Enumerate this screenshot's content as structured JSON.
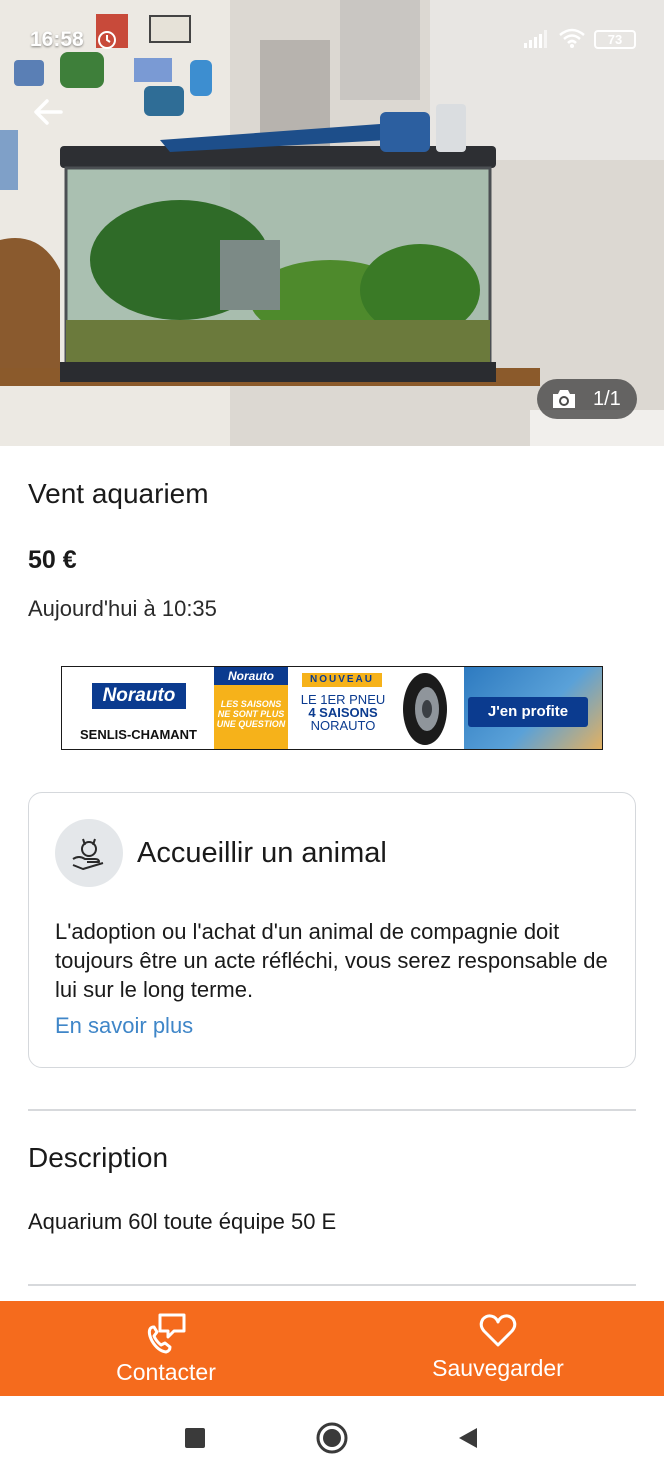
{
  "status_bar": {
    "time": "16:58",
    "battery": "73",
    "icons": [
      "alarm-icon",
      "signal-icon",
      "wifi-icon",
      "battery-icon"
    ]
  },
  "photo": {
    "counter": "1/1",
    "icons": [
      "back-arrow-icon",
      "camera-icon"
    ]
  },
  "listing": {
    "title": "Vent aquariem",
    "price": "50 €",
    "date": "Aujourd'hui à 10:35"
  },
  "ad": {
    "brand": "Norauto",
    "location": "SENLIS-CHAMANT",
    "tagline": "LES SAISONS NE SONT PLUS UNE QUESTION",
    "badge": "NOUVEAU",
    "headline_1": "LE 1ER PNEU",
    "headline_2": "4 SAISONS",
    "headline_3": "NORAUTO",
    "cta": "J'en profite"
  },
  "info_card": {
    "title": "Accueillir un animal",
    "body": "L'adoption ou l'achat d'un animal de compagnie doit toujours être un acte réfléchi, vous serez responsable de lui sur le long terme.",
    "link": "En savoir plus",
    "icon": "pet-care-icon"
  },
  "description": {
    "title": "Description",
    "text": "Aquarium 60l toute équipe 50 E"
  },
  "actions": {
    "contact_label": "Contacter",
    "save_label": "Sauvegarder"
  },
  "navigation": {
    "buttons": [
      "recents-square-icon",
      "home-circle-icon",
      "back-triangle-icon"
    ]
  },
  "colors": {
    "accent": "#f56b1d",
    "link": "#3f86c8",
    "ad_blue": "#0b3b8f",
    "ad_yellow": "#f6b21a"
  }
}
